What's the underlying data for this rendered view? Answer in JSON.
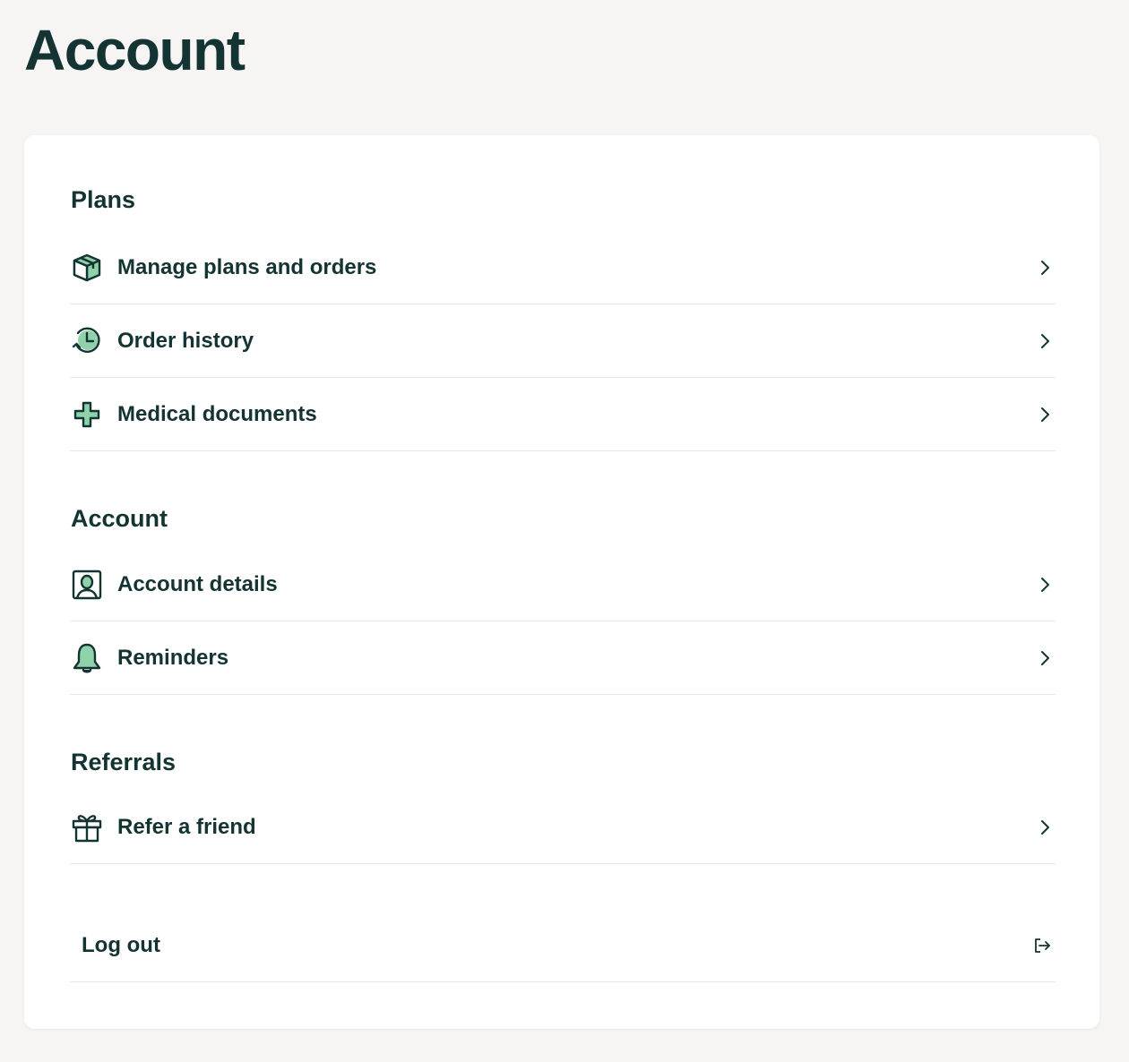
{
  "page": {
    "title": "Account"
  },
  "colors": {
    "text": "#143433",
    "accent_green": "#8fd1a8",
    "background": "#f6f5f3",
    "card": "#ffffff",
    "divider": "#e6e6e4"
  },
  "sections": {
    "plans": {
      "title": "Plans",
      "items": [
        {
          "label": "Manage plans and orders",
          "icon": "package-box-icon"
        },
        {
          "label": "Order history",
          "icon": "clock-history-icon"
        },
        {
          "label": "Medical documents",
          "icon": "medical-cross-icon"
        }
      ]
    },
    "account": {
      "title": "Account",
      "items": [
        {
          "label": "Account details",
          "icon": "profile-card-icon"
        },
        {
          "label": "Reminders",
          "icon": "bell-icon"
        }
      ]
    },
    "referrals": {
      "title": "Referrals",
      "items": [
        {
          "label": "Refer a friend",
          "icon": "gift-icon"
        }
      ]
    }
  },
  "logout": {
    "label": "Log out",
    "icon": "logout-icon"
  }
}
